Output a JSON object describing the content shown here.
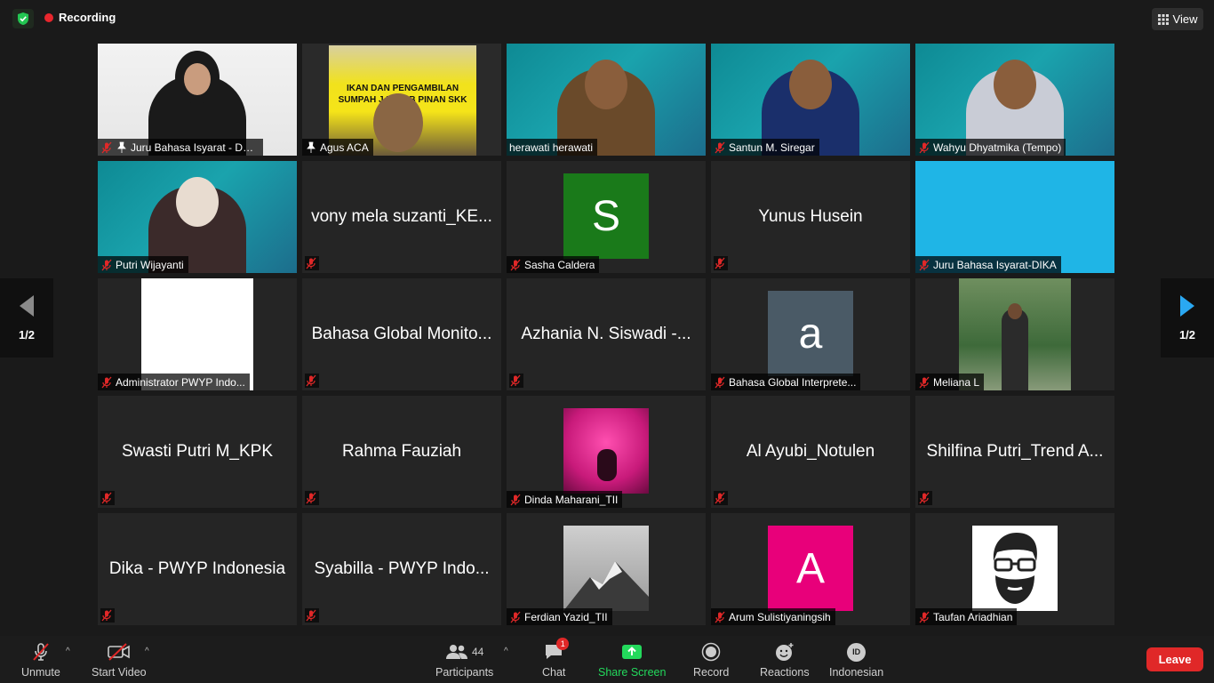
{
  "top_bar": {
    "recording_label": "Recording",
    "view_label": "View"
  },
  "pagination": {
    "left": "1/2",
    "right": "1/2"
  },
  "tiles": [
    {
      "name": "Juru Bahasa Isyarat - Dhita",
      "type": "video-light"
    },
    {
      "name": "Agus ACA",
      "type": "video-yellow",
      "banner": "IKAN DAN PENGAMBILAN SUMPAH J PEJAB PINAN SKK MIGAS"
    },
    {
      "name": "herawati herawati",
      "type": "video-slide"
    },
    {
      "name": "Santun M. Siregar",
      "type": "video-slide"
    },
    {
      "name": "Wahyu Dhyatmika (Tempo)",
      "type": "video-slide"
    },
    {
      "name": "Putri Wijayanti",
      "type": "video-slide"
    },
    {
      "name": "vony mela suzanti_KE...",
      "type": "name-only"
    },
    {
      "name": "Sasha Caldera",
      "type": "avatar",
      "letter": "S",
      "color": "#1a7a1a"
    },
    {
      "name": "Yunus Husein",
      "type": "name-only"
    },
    {
      "name": "Juru Bahasa Isyarat-DIKA",
      "type": "blue"
    },
    {
      "name": "Administrator PWYP Indo...",
      "type": "white-pic"
    },
    {
      "name": "Bahasa Global Monito...",
      "type": "name-only"
    },
    {
      "name": "Azhania N. Siswadi -...",
      "type": "name-only"
    },
    {
      "name": "Bahasa Global Interprete...",
      "type": "avatar",
      "letter": "a",
      "color": "#4a5a66"
    },
    {
      "name": "Meliana L",
      "type": "photo-garden"
    },
    {
      "name": "Swasti Putri M_KPK",
      "type": "name-only"
    },
    {
      "name": "Rahma Fauziah",
      "type": "name-only"
    },
    {
      "name": "Dinda Maharani_TII",
      "type": "photo-pink"
    },
    {
      "name": "Al Ayubi_Notulen",
      "type": "name-only"
    },
    {
      "name": "Shilfina Putri_Trend A...",
      "type": "name-only"
    },
    {
      "name": "Dika - PWYP Indonesia",
      "type": "name-only"
    },
    {
      "name": "Syabilla - PWYP Indo...",
      "type": "name-only"
    },
    {
      "name": "Ferdian Yazid_TII",
      "type": "photo-mountain"
    },
    {
      "name": "Arum Sulistiyaningsih",
      "type": "avatar",
      "letter": "A",
      "color": "#e8007a"
    },
    {
      "name": "Taufan Ariadhian",
      "type": "photo-cartoon"
    }
  ],
  "toolbar": {
    "unmute": "Unmute",
    "start_video": "Start Video",
    "participants": "Participants",
    "participants_count": "44",
    "chat": "Chat",
    "chat_badge": "1",
    "share_screen": "Share Screen",
    "record": "Record",
    "reactions": "Reactions",
    "interpretation": "Indonesian",
    "interpretation_code": "ID",
    "leave": "Leave"
  },
  "colors": {
    "active_speaker": "#c4e07a",
    "share_green": "#23d95c",
    "leave_red": "#e02828"
  }
}
